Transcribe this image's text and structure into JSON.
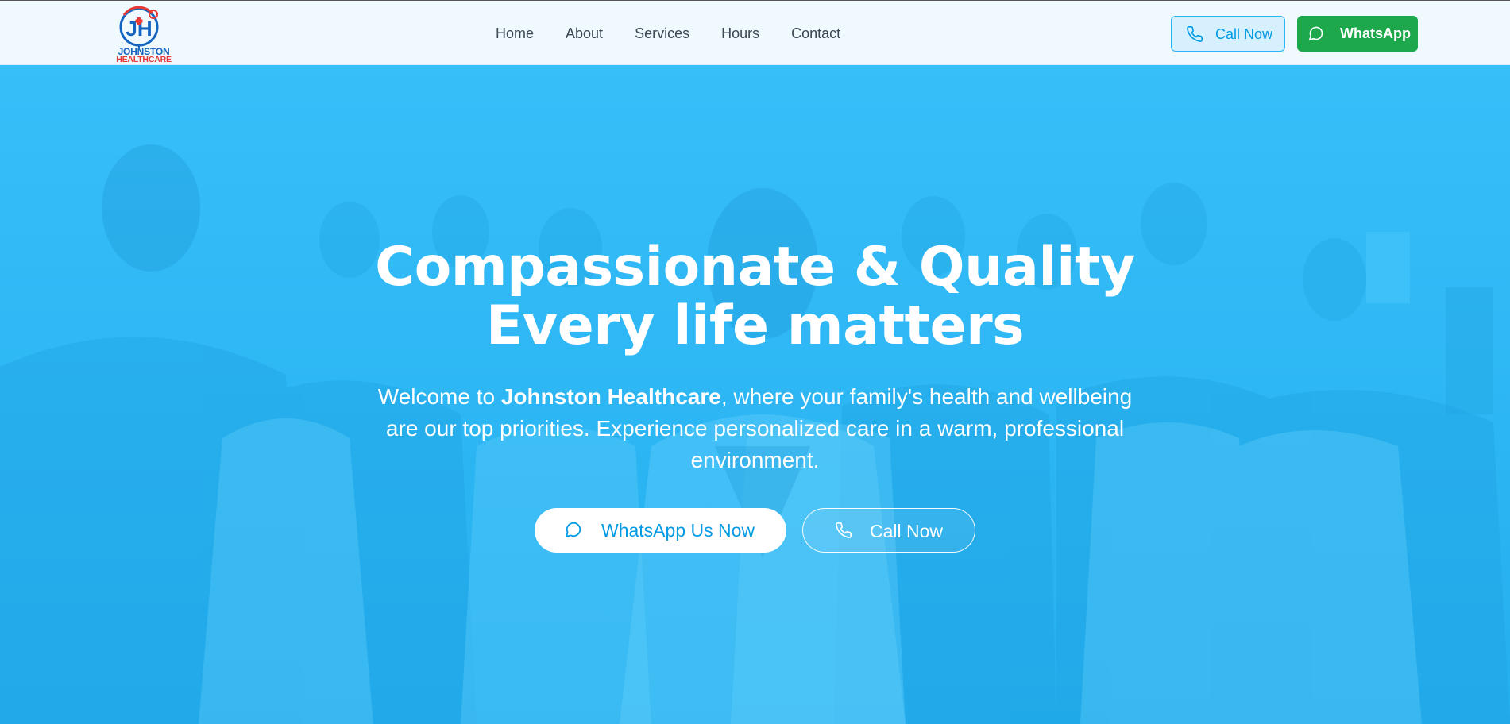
{
  "brand": {
    "logo_monogram": "JH",
    "name_line1": "JOHNSTON",
    "name_line2": "HEALTHCARE",
    "colors": {
      "primary": "#1565c0",
      "accent": "#e53935"
    }
  },
  "nav": {
    "items": [
      {
        "label": "Home"
      },
      {
        "label": "About"
      },
      {
        "label": "Services"
      },
      {
        "label": "Hours"
      },
      {
        "label": "Contact"
      }
    ]
  },
  "header_actions": {
    "call": {
      "label": "Call Now",
      "icon": "phone-icon"
    },
    "whatsapp": {
      "label": "WhatsApp",
      "icon": "chat-bubble-icon"
    }
  },
  "hero": {
    "title_line1": "Compassionate & Quality",
    "title_line2": "Every life matters",
    "subtitle_before": "Welcome to ",
    "subtitle_brand": "Johnston Healthcare",
    "subtitle_after": ", where your family's health and wellbeing are our top priorities. Experience personalized care in a warm, professional environment.",
    "cta_whatsapp": {
      "label": "WhatsApp Us Now",
      "icon": "chat-bubble-icon"
    },
    "cta_call": {
      "label": "Call Now",
      "icon": "phone-icon"
    },
    "background_image": "medical team photo (doctors in white coats)"
  },
  "colors": {
    "hero_tint": "#29b6f6",
    "header_bg": "#eff9fe",
    "whatsapp_green": "#1ea84c",
    "call_blue": "#039be5"
  }
}
